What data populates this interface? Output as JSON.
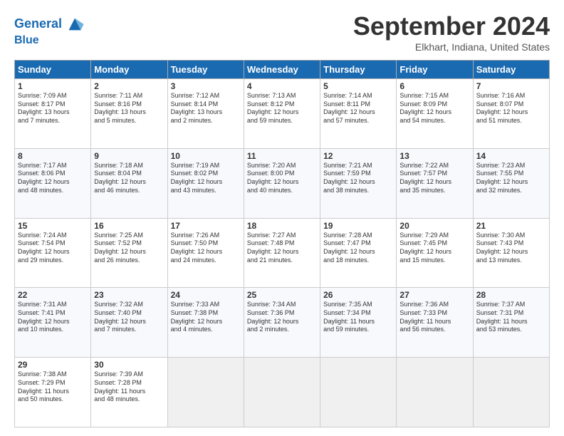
{
  "logo": {
    "line1": "General",
    "line2": "Blue"
  },
  "title": "September 2024",
  "location": "Elkhart, Indiana, United States",
  "headers": [
    "Sunday",
    "Monday",
    "Tuesday",
    "Wednesday",
    "Thursday",
    "Friday",
    "Saturday"
  ],
  "weeks": [
    [
      {
        "num": "1",
        "detail": "Sunrise: 7:09 AM\nSunset: 8:17 PM\nDaylight: 13 hours\nand 7 minutes."
      },
      {
        "num": "2",
        "detail": "Sunrise: 7:11 AM\nSunset: 8:16 PM\nDaylight: 13 hours\nand 5 minutes."
      },
      {
        "num": "3",
        "detail": "Sunrise: 7:12 AM\nSunset: 8:14 PM\nDaylight: 13 hours\nand 2 minutes."
      },
      {
        "num": "4",
        "detail": "Sunrise: 7:13 AM\nSunset: 8:12 PM\nDaylight: 12 hours\nand 59 minutes."
      },
      {
        "num": "5",
        "detail": "Sunrise: 7:14 AM\nSunset: 8:11 PM\nDaylight: 12 hours\nand 57 minutes."
      },
      {
        "num": "6",
        "detail": "Sunrise: 7:15 AM\nSunset: 8:09 PM\nDaylight: 12 hours\nand 54 minutes."
      },
      {
        "num": "7",
        "detail": "Sunrise: 7:16 AM\nSunset: 8:07 PM\nDaylight: 12 hours\nand 51 minutes."
      }
    ],
    [
      {
        "num": "8",
        "detail": "Sunrise: 7:17 AM\nSunset: 8:06 PM\nDaylight: 12 hours\nand 48 minutes."
      },
      {
        "num": "9",
        "detail": "Sunrise: 7:18 AM\nSunset: 8:04 PM\nDaylight: 12 hours\nand 46 minutes."
      },
      {
        "num": "10",
        "detail": "Sunrise: 7:19 AM\nSunset: 8:02 PM\nDaylight: 12 hours\nand 43 minutes."
      },
      {
        "num": "11",
        "detail": "Sunrise: 7:20 AM\nSunset: 8:00 PM\nDaylight: 12 hours\nand 40 minutes."
      },
      {
        "num": "12",
        "detail": "Sunrise: 7:21 AM\nSunset: 7:59 PM\nDaylight: 12 hours\nand 38 minutes."
      },
      {
        "num": "13",
        "detail": "Sunrise: 7:22 AM\nSunset: 7:57 PM\nDaylight: 12 hours\nand 35 minutes."
      },
      {
        "num": "14",
        "detail": "Sunrise: 7:23 AM\nSunset: 7:55 PM\nDaylight: 12 hours\nand 32 minutes."
      }
    ],
    [
      {
        "num": "15",
        "detail": "Sunrise: 7:24 AM\nSunset: 7:54 PM\nDaylight: 12 hours\nand 29 minutes."
      },
      {
        "num": "16",
        "detail": "Sunrise: 7:25 AM\nSunset: 7:52 PM\nDaylight: 12 hours\nand 26 minutes."
      },
      {
        "num": "17",
        "detail": "Sunrise: 7:26 AM\nSunset: 7:50 PM\nDaylight: 12 hours\nand 24 minutes."
      },
      {
        "num": "18",
        "detail": "Sunrise: 7:27 AM\nSunset: 7:48 PM\nDaylight: 12 hours\nand 21 minutes."
      },
      {
        "num": "19",
        "detail": "Sunrise: 7:28 AM\nSunset: 7:47 PM\nDaylight: 12 hours\nand 18 minutes."
      },
      {
        "num": "20",
        "detail": "Sunrise: 7:29 AM\nSunset: 7:45 PM\nDaylight: 12 hours\nand 15 minutes."
      },
      {
        "num": "21",
        "detail": "Sunrise: 7:30 AM\nSunset: 7:43 PM\nDaylight: 12 hours\nand 13 minutes."
      }
    ],
    [
      {
        "num": "22",
        "detail": "Sunrise: 7:31 AM\nSunset: 7:41 PM\nDaylight: 12 hours\nand 10 minutes."
      },
      {
        "num": "23",
        "detail": "Sunrise: 7:32 AM\nSunset: 7:40 PM\nDaylight: 12 hours\nand 7 minutes."
      },
      {
        "num": "24",
        "detail": "Sunrise: 7:33 AM\nSunset: 7:38 PM\nDaylight: 12 hours\nand 4 minutes."
      },
      {
        "num": "25",
        "detail": "Sunrise: 7:34 AM\nSunset: 7:36 PM\nDaylight: 12 hours\nand 2 minutes."
      },
      {
        "num": "26",
        "detail": "Sunrise: 7:35 AM\nSunset: 7:34 PM\nDaylight: 11 hours\nand 59 minutes."
      },
      {
        "num": "27",
        "detail": "Sunrise: 7:36 AM\nSunset: 7:33 PM\nDaylight: 11 hours\nand 56 minutes."
      },
      {
        "num": "28",
        "detail": "Sunrise: 7:37 AM\nSunset: 7:31 PM\nDaylight: 11 hours\nand 53 minutes."
      }
    ],
    [
      {
        "num": "29",
        "detail": "Sunrise: 7:38 AM\nSunset: 7:29 PM\nDaylight: 11 hours\nand 50 minutes."
      },
      {
        "num": "30",
        "detail": "Sunrise: 7:39 AM\nSunset: 7:28 PM\nDaylight: 11 hours\nand 48 minutes."
      },
      {
        "num": "",
        "detail": ""
      },
      {
        "num": "",
        "detail": ""
      },
      {
        "num": "",
        "detail": ""
      },
      {
        "num": "",
        "detail": ""
      },
      {
        "num": "",
        "detail": ""
      }
    ]
  ]
}
